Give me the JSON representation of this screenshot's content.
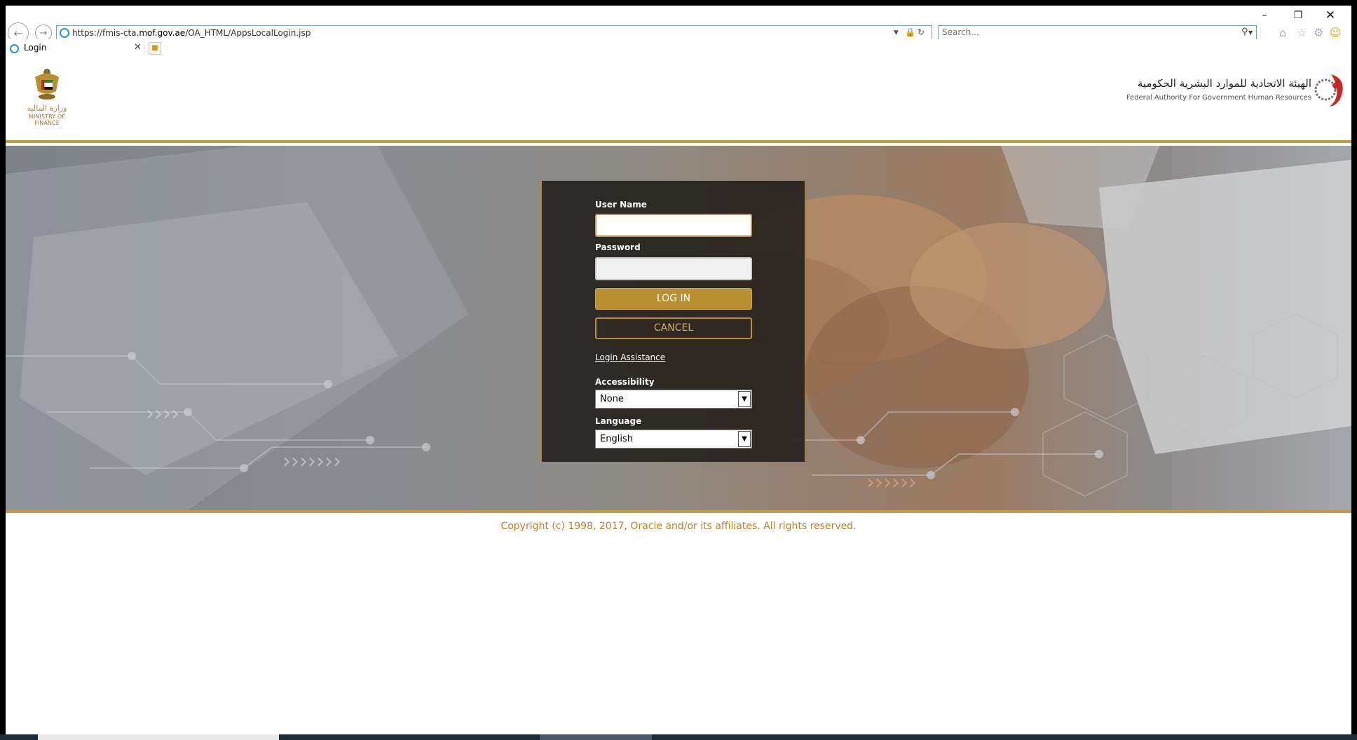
{
  "browser": {
    "url_prefix": "https://fmis-cta.",
    "url_domain": "mof.gov.ae",
    "url_path": "/OA_HTML/AppsLocalLogin.jsp",
    "search_placeholder": "Search...",
    "tab_title": "Login",
    "back_icon": "back-arrow-icon",
    "forward_icon": "forward-arrow-icon"
  },
  "header": {
    "mof_arabic": "وزارة المالية",
    "mof_english": "MINISTRY OF FINANCE",
    "fahr_arabic": "الهيئة الاتحادية للموارد البشرية الحكومية",
    "fahr_english": "Federal Authority For Government Human Resources"
  },
  "login": {
    "username_label": "User Name",
    "username_value": "",
    "password_label": "Password",
    "password_value": "",
    "login_button": "LOG IN",
    "cancel_button": "CANCEL",
    "assistance_link": "Login Assistance",
    "accessibility_label": "Accessibility",
    "accessibility_value": "None",
    "language_label": "Language",
    "language_value": "English"
  },
  "footer": {
    "copyright": "Copyright (c) 1998, 2017, Oracle and/or its affiliates. All rights reserved."
  },
  "colors": {
    "accent_gold": "#b8902f",
    "copyright_text": "#b8862b",
    "panel_bg": "#26221e"
  }
}
